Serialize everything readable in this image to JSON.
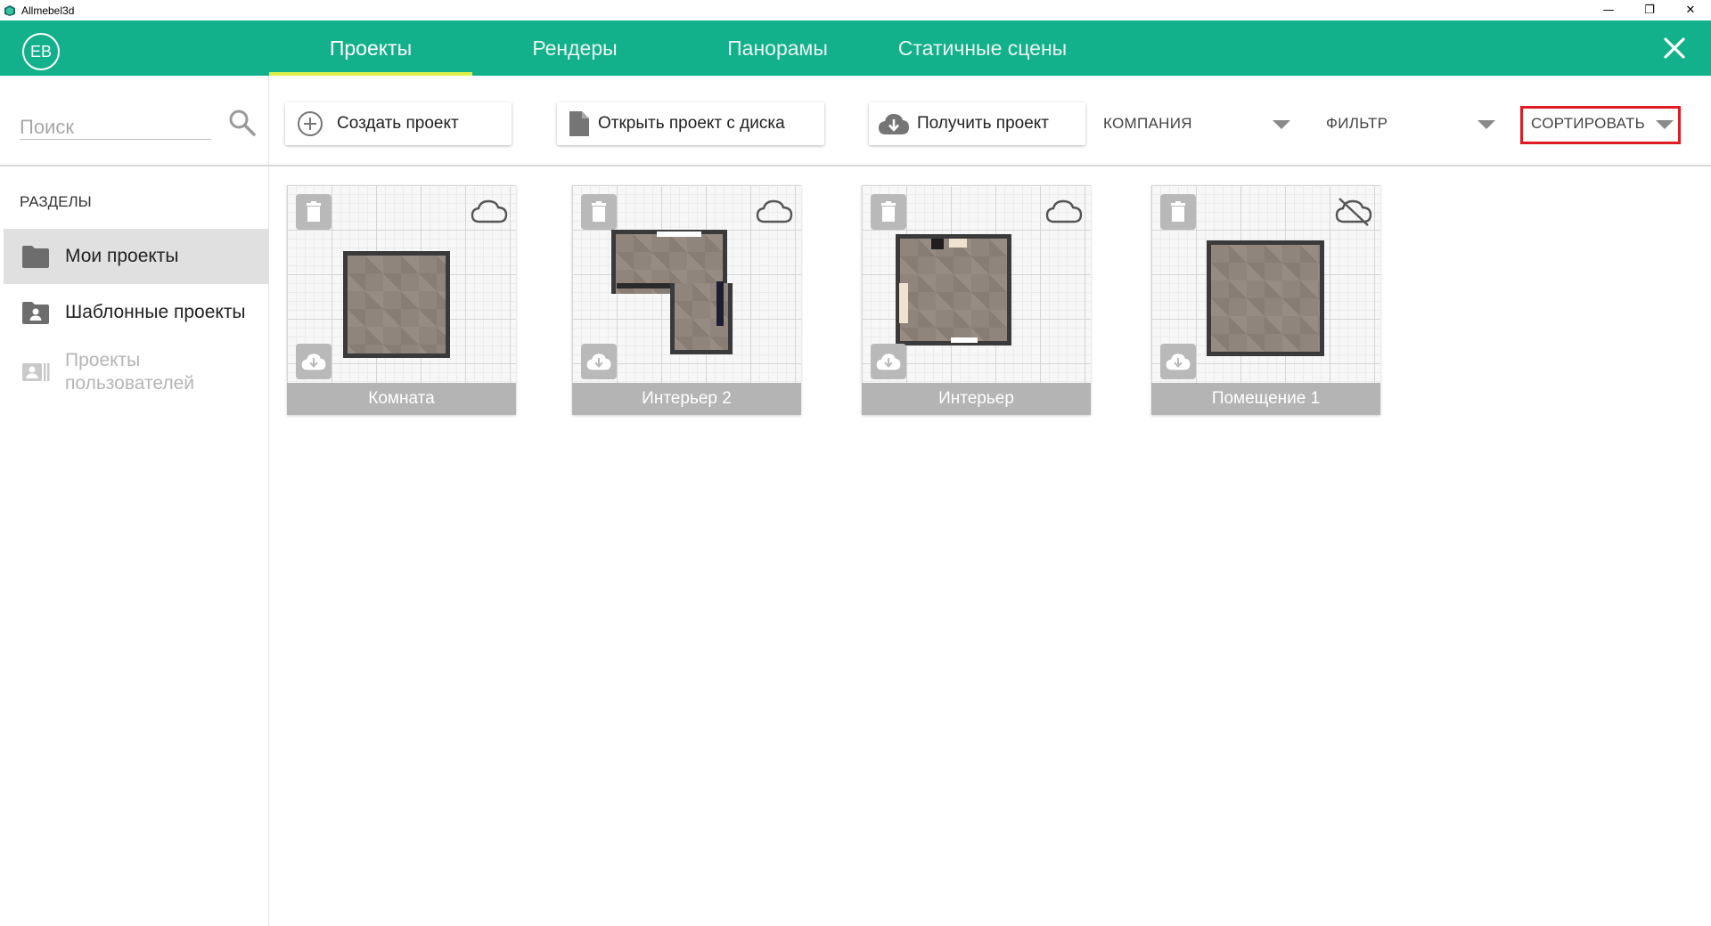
{
  "window": {
    "title": "Allmebel3d",
    "controls": {
      "minimize": "—",
      "restore": "❐",
      "close": "✕"
    }
  },
  "header": {
    "avatar_initials": "EB",
    "tabs": [
      {
        "label": "Проекты",
        "active": true
      },
      {
        "label": "Рендеры",
        "active": false
      },
      {
        "label": "Панорамы",
        "active": false
      },
      {
        "label": "Статичные сцены",
        "active": false
      }
    ],
    "accent_color": "#13b08c",
    "active_underline_color": "#ddf04a"
  },
  "sidebar": {
    "search_placeholder": "Поиск",
    "sections_title": "РАЗДЕЛЫ",
    "items": [
      {
        "label": "Мои проекты",
        "icon": "folder-icon",
        "selected": true,
        "enabled": true
      },
      {
        "label": "Шаблонные проекты",
        "icon": "user-folder-icon",
        "selected": false,
        "enabled": true
      },
      {
        "label": "Проекты пользователей",
        "icon": "users-card-icon",
        "selected": false,
        "enabled": false
      }
    ]
  },
  "toolbar": {
    "create_label": "Создать проект",
    "open_label": "Открыть проект с диска",
    "receive_label": "Получить проект",
    "company_label": "КОМПАНИЯ",
    "filter_label": "ФИЛЬТР",
    "sort_label": "СОРТИРОВАТЬ",
    "sort_highlight_color": "#e01b22"
  },
  "projects": [
    {
      "name": "Комната",
      "cloud": "cloud-icon"
    },
    {
      "name": "Интерьер 2",
      "cloud": "cloud-icon"
    },
    {
      "name": "Интерьер",
      "cloud": "cloud-icon"
    },
    {
      "name": "Помещение 1",
      "cloud": "cloud-off-icon"
    }
  ]
}
